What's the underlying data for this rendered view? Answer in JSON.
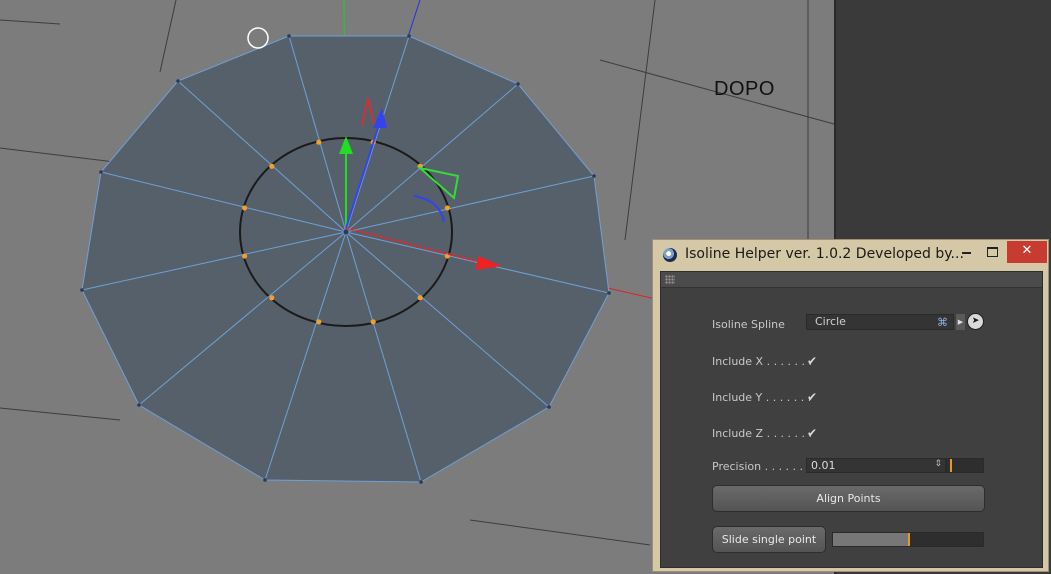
{
  "viewport": {
    "label": "DOPO",
    "colors": {
      "background": "#7c7c7c",
      "mesh_fill": "#56606b",
      "mesh_edge": "#6fa0d6",
      "selected_point": "#f0a030",
      "axis_x": "#e02020",
      "axis_y": "#20d020",
      "axis_z": "#2030e0"
    }
  },
  "dialog": {
    "title": "Isoline Helper ver. 1.0.2 Developed by...",
    "close_glyph": "✕",
    "fields": {
      "isoline_spline_label": "Isoline Spline",
      "isoline_spline_value": "Circle",
      "include_x_label": "Include X . . . . . . .",
      "include_x_checked": true,
      "include_y_label": "Include Y . . . . . . .",
      "include_y_checked": true,
      "include_z_label": "Include Z . . . . . . .",
      "include_z_checked": true,
      "precision_label": "Precision . . . . . . .",
      "precision_value": "0.01",
      "precision_slider_level": 0.08
    },
    "buttons": {
      "align_points": "Align Points",
      "slide_single_point": "Slide single point"
    },
    "slide_slider_level": 0.5,
    "icons": {
      "spline_link": "spline-icon",
      "pick": "arrow-cursor-icon",
      "grip": "grip-icon"
    }
  }
}
